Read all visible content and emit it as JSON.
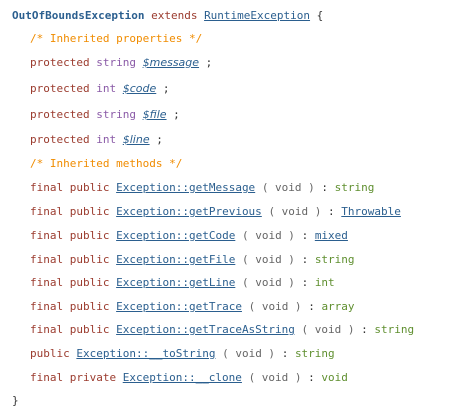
{
  "class_decl": {
    "name": "OutOfBoundsException",
    "extends_kw": "extends",
    "parent": "RuntimeException",
    "open": "{"
  },
  "comments": {
    "properties": "/* Inherited properties */",
    "methods": "/* Inherited methods */"
  },
  "properties": [
    {
      "modifier": "protected",
      "type": "string",
      "name": "$message",
      "end": " ;"
    },
    {
      "modifier": "protected",
      "type": "int",
      "name": "$code",
      "end": " ;"
    },
    {
      "modifier": "protected",
      "type": "string",
      "name": "$file",
      "end": " ;"
    },
    {
      "modifier": "protected",
      "type": "int",
      "name": "$line",
      "end": " ;"
    }
  ],
  "methods": [
    {
      "modifiers": "final public",
      "name": "Exception::getMessage",
      "args": "( void )",
      "colon": ":",
      "ret": "string",
      "ret_link": false
    },
    {
      "modifiers": "final public",
      "name": "Exception::getPrevious",
      "args": "( void )",
      "colon": ":",
      "ret": "Throwable",
      "ret_link": true
    },
    {
      "modifiers": "final public",
      "name": "Exception::getCode",
      "args": "( void )",
      "colon": ":",
      "ret": "mixed",
      "ret_link": true
    },
    {
      "modifiers": "final public",
      "name": "Exception::getFile",
      "args": "( void )",
      "colon": ":",
      "ret": "string",
      "ret_link": false
    },
    {
      "modifiers": "final public",
      "name": "Exception::getLine",
      "args": "( void )",
      "colon": ":",
      "ret": "int",
      "ret_link": false
    },
    {
      "modifiers": "final public",
      "name": "Exception::getTrace",
      "args": "( void )",
      "colon": ":",
      "ret": "array",
      "ret_link": false
    },
    {
      "modifiers": "final public",
      "name": "Exception::getTraceAsString",
      "args": "( void )",
      "colon": ":",
      "ret": "string",
      "ret_link": false
    },
    {
      "modifiers": "public",
      "name": "Exception::__toString",
      "args": "( void )",
      "colon": ":",
      "ret": "string",
      "ret_link": false
    },
    {
      "modifiers": "final private",
      "name": "Exception::__clone",
      "args": "( void )",
      "colon": ":",
      "ret": "void",
      "ret_link": false
    }
  ],
  "close": "}"
}
